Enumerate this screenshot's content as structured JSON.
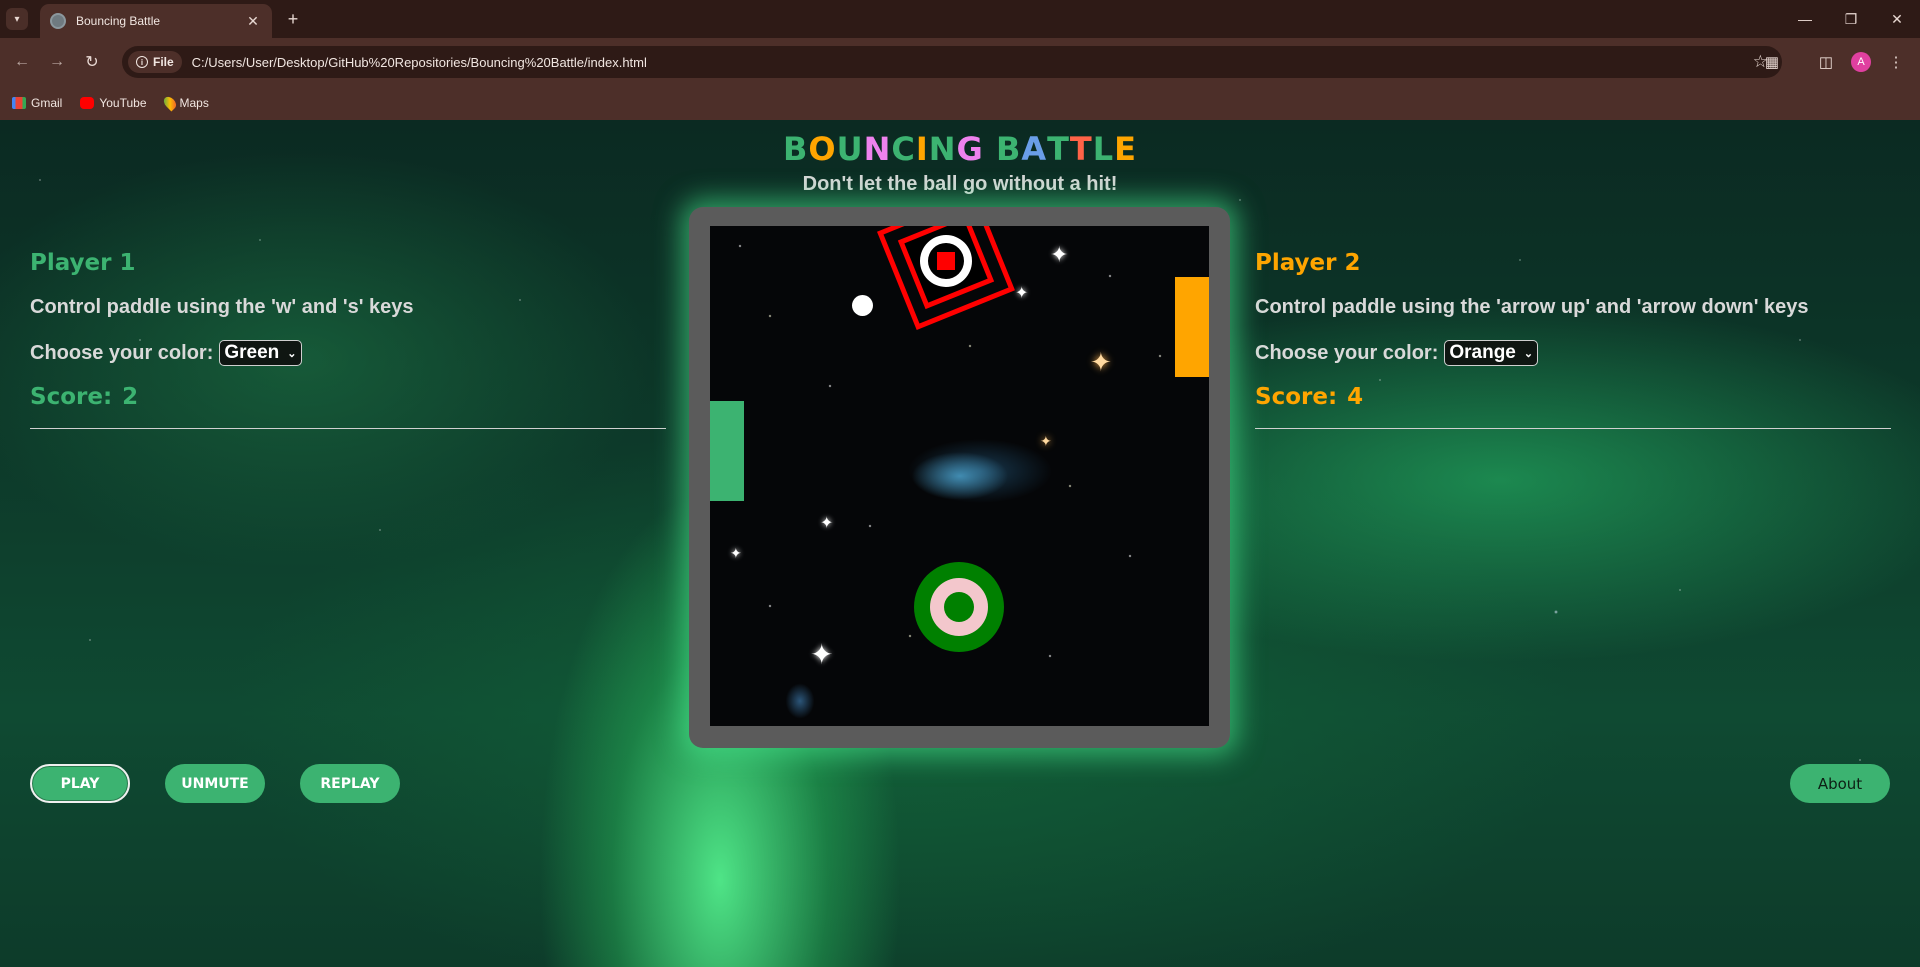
{
  "browser": {
    "tab_title": "Bouncing Battle",
    "tab_close": "✕",
    "new_tab": "+",
    "address_chip": "File",
    "url": "C:/Users/User/Desktop/GitHub%20Repositories/Bouncing%20Battle/index.html",
    "avatar_letter": "A",
    "bookmarks": [
      {
        "label": "Gmail",
        "icon": "gmail-icon"
      },
      {
        "label": "YouTube",
        "icon": "youtube-icon"
      },
      {
        "label": "Maps",
        "icon": "maps-icon"
      }
    ]
  },
  "game": {
    "title_letters": [
      {
        "ch": "B",
        "color": "#3cb371"
      },
      {
        "ch": "O",
        "color": "#ffa500"
      },
      {
        "ch": "U",
        "color": "#3cb371"
      },
      {
        "ch": "N",
        "color": "#ee82ee"
      },
      {
        "ch": "C",
        "color": "#3cb371"
      },
      {
        "ch": "I",
        "color": "#ffa500"
      },
      {
        "ch": "N",
        "color": "#3cb371"
      },
      {
        "ch": "G",
        "color": "#ee82ee"
      },
      {
        "ch": " ",
        "color": "#ffffff"
      },
      {
        "ch": "B",
        "color": "#3cb371"
      },
      {
        "ch": "A",
        "color": "#6a9ee8"
      },
      {
        "ch": "T",
        "color": "#3cb371"
      },
      {
        "ch": "T",
        "color": "#ff6347"
      },
      {
        "ch": "L",
        "color": "#3cb371"
      },
      {
        "ch": "E",
        "color": "#ffa500"
      }
    ],
    "subtitle": "Don't let the ball go without a hit!"
  },
  "player1": {
    "name": "Player 1",
    "description": "Control paddle using the 'w' and 's' keys",
    "color_label": "Choose your color:",
    "color_value": "Green",
    "score_label": "Score:",
    "score": "2",
    "accent": "#3cb371"
  },
  "player2": {
    "name": "Player 2",
    "description": "Control paddle using the 'arrow up' and 'arrow down' keys",
    "color_label": "Choose your color:",
    "color_value": "Orange",
    "score_label": "Score:",
    "score": "4",
    "accent": "#ffa500"
  },
  "controls": {
    "play": "PLAY",
    "unmute": "UNMUTE",
    "replay": "REPLAY",
    "about": "About"
  }
}
